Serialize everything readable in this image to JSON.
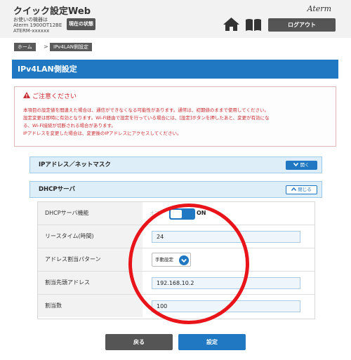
{
  "header": {
    "title": "クイック設定Web",
    "device_lines": [
      "お使いの機器は",
      "Aterm 1900OT12BE",
      "ATERM-xxxxxx"
    ],
    "status_button": "現在の状態",
    "brand": "Aterm",
    "logout_button": "ログアウト"
  },
  "breadcrumb": {
    "home": "ホーム",
    "separator": ">",
    "current": "IPv4LAN側設定"
  },
  "page_title": "IPv4LAN側設定",
  "caution": {
    "title": "ご注意ください",
    "lines": [
      "本項目の設定値を間違えた場合は、通信ができなくなる可能性があります。通常は、初期値のままで使用してください。",
      "設定変更は即時に有効となります。Wi-Fi経由で設定を行っている場合には、[設定]ボタンを押したあと、変更が有効にな",
      "る、Wi-Fi接続が切断される場合があります。",
      "IPアドレスを変更した場合は、変更後のIPアドレスにアクセスしてください。"
    ]
  },
  "sections": {
    "ip_mask": {
      "title": "IPアドレス／ネットマスク",
      "button": "開く"
    },
    "dhcp": {
      "title": "DHCPサーバ",
      "button": "閉じる"
    }
  },
  "table": {
    "rows": [
      {
        "label": "DHCPサーバ機能",
        "off_text": "オフ",
        "on_text": "ON",
        "state": "on"
      },
      {
        "label": "リースタイム(時間)",
        "value": "24"
      },
      {
        "label": "アドレス割当パターン",
        "value": "手動設定"
      },
      {
        "label": "割当先頭アドレス",
        "value": "192.168.10.2"
      },
      {
        "label": "割当数",
        "value": "100"
      }
    ]
  },
  "buttons": {
    "back": "戻る",
    "set": "設定"
  },
  "colors": {
    "accent": "#1f78c1",
    "caution_red": "#c8282d",
    "annotation_circle": "#e8141a",
    "dark_button": "#555555"
  }
}
